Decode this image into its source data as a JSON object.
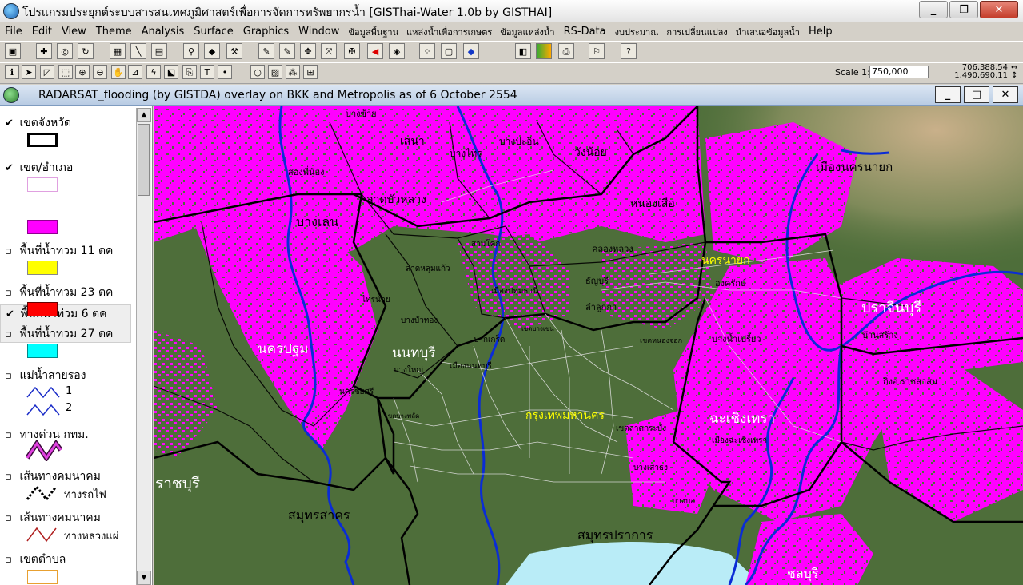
{
  "window": {
    "title": "โปรแกรมประยุกต์ระบบสารสนเทศภูมิศาสตร์เพื่อการจัดการทรัพยากรน้ำ  [GISThai-Water 1.0b   by GISTHAI]",
    "minimize": "_",
    "restore": "❐",
    "close": "✕"
  },
  "menu": [
    "File",
    "Edit",
    "View",
    "Theme",
    "Analysis",
    "Surface",
    "Graphics",
    "Window",
    "ข้อมูลพื้นฐาน",
    "แหล่งน้ำเพื่อการเกษตร",
    "ข้อมูลแหล่งน้ำ",
    "RS-Data",
    "งบประมาณ",
    "การเปลี่ยนแปลง",
    "นำเสนอข้อมูลน้ำ",
    "Help"
  ],
  "toolbar": {
    "scale_label": "Scale 1:",
    "scale_value": "750,000",
    "coord_x": "706,388.54",
    "coord_y": "1,490,690.11"
  },
  "view": {
    "title": "RADARSAT_flooding (by GISTDA) overlay on BKK and Metropolis as of 6 October 2554",
    "minimize": "_",
    "maximize": "□",
    "close": "✕"
  },
  "toc": [
    {
      "label": "เขตจังหวัด",
      "checked": true
    },
    {
      "label": "เขต/อำเภอ",
      "checked": true
    },
    {
      "label": "พื้นที่น้ำท่วม 6 ตค",
      "checked": true
    },
    {
      "label": "พื้นที่น้ำท่วม 11 ตค",
      "checked": false
    },
    {
      "label": "พื้นที่น้ำท่วม 23 ตค",
      "checked": false
    },
    {
      "label": "พื้นที่น้ำท่วม 27 ตค",
      "checked": false
    },
    {
      "label": "แม่น้ำสายรอง",
      "checked": false,
      "legend": [
        "1",
        "2"
      ]
    },
    {
      "label": "ทางด่วน กทม.",
      "checked": false
    },
    {
      "label": "เส้นทางคมนาคม",
      "checked": false,
      "sublabel": "ทางรถไฟ"
    },
    {
      "label": "เส้นทางคมนาคม",
      "checked": false,
      "sublabel": "ทางหลวงแผ่"
    },
    {
      "label": "เขตตำบล",
      "checked": false
    }
  ],
  "colors": {
    "flood6": "#ff00ff",
    "flood11": "#ffff00",
    "flood23": "#ff0000",
    "flood27": "#00ffff",
    "land": "#4e6e3a",
    "river": "#0a2cd6",
    "sea": "#b9ecf7"
  },
  "map": {
    "provinces": [
      {
        "name": "นครปฐม",
        "color": "#ffffff"
      },
      {
        "name": "นนทบุรี",
        "color": "#ffffff"
      },
      {
        "name": "กรุงเทพมหานคร",
        "color": "#ffff00"
      },
      {
        "name": "ฉะเชิงเทรา",
        "color": "#ffffff"
      },
      {
        "name": "ปราจีนบุรี",
        "color": "#ffffff"
      },
      {
        "name": "นครนายก",
        "color": "#ffff00"
      },
      {
        "name": "สมุทรสาคร",
        "color": "#000000"
      },
      {
        "name": "สมุทรปราการ",
        "color": "#000000"
      },
      {
        "name": "ราชบุรี",
        "color": "#ffffff"
      },
      {
        "name": "ชลบุรี",
        "color": "#ffffff"
      }
    ],
    "districts": [
      "เสนา",
      "บางไทร",
      "บางปะอิน",
      "วังน้อย",
      "หนองเสือ",
      "ลาดบัวหลวง",
      "บางเลน",
      "สองพี่น้อง",
      "บางซ้าย",
      "เมืองนครนายก",
      "องครักษ์",
      "ธัญบุรี",
      "คลองหลวง",
      "สามโคก",
      "ลาดหลุมแก้ว",
      "เมืองปทุมธานี",
      "ลำลูกกา",
      "ไทรน้อย",
      "บางบัวทอง",
      "บางใหญ่",
      "เมืองนนทบุรี",
      "ปากเกร็ด",
      "นครชัยศรี",
      "บางน้ำเปรี้ยว",
      "บ้านสร้าง",
      "กิ่งอ.ราชสาสน",
      "เมืองฉะเชิงเทรา",
      "บางเสาธง",
      "บางบอ",
      "เขตลาดกระบัง",
      "เขตหนองจอก",
      "เขตบางพลัด",
      "เขตบางเขน"
    ]
  }
}
